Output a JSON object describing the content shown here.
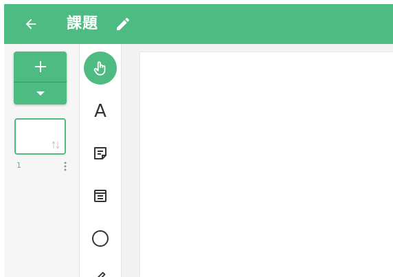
{
  "header": {
    "title": "課題",
    "back_icon": "arrow-left-icon",
    "edit_icon": "pencil-icon",
    "color": "#4dbb82"
  },
  "pages": {
    "add_icon": "plus-icon",
    "dropdown_icon": "caret-down-icon",
    "items": [
      {
        "number": "1"
      }
    ]
  },
  "tools": {
    "active": "select",
    "text_glyph": "A",
    "items": [
      "select",
      "text",
      "sticky-note",
      "card",
      "circle",
      "pen"
    ]
  }
}
